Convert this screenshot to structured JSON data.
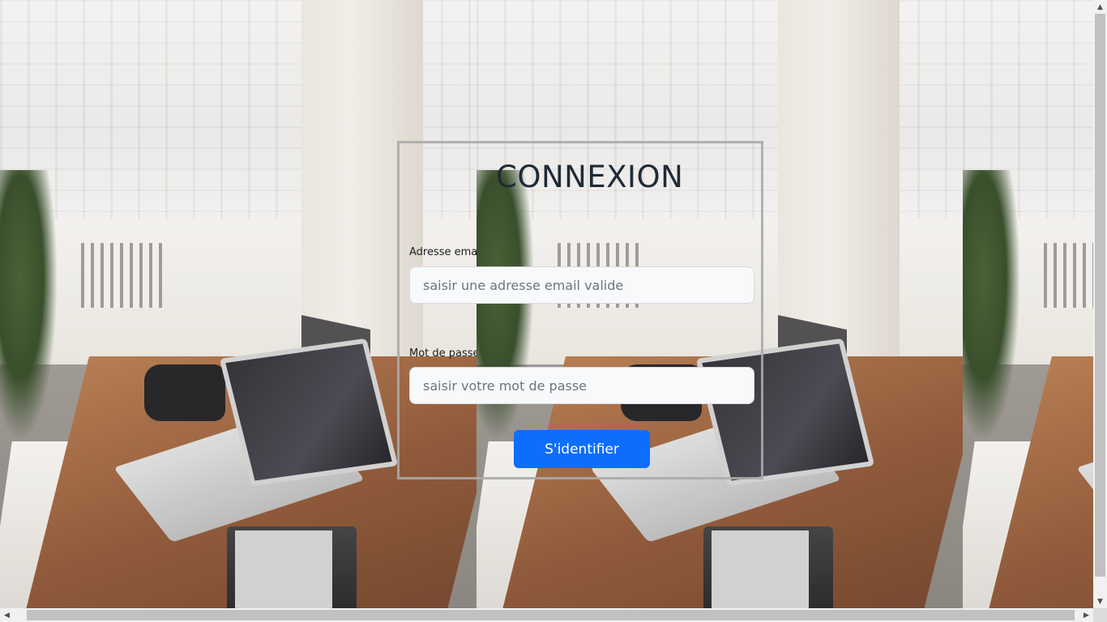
{
  "login": {
    "title": "CONNEXION",
    "email_label": "Adresse email",
    "email_placeholder": "saisir une adresse email valide",
    "email_value": "",
    "password_label": "Mot de passe",
    "password_placeholder": "saisir votre mot de passe",
    "password_value": "",
    "submit_label": "S'identifier"
  },
  "colors": {
    "accent": "#0d6efd",
    "title": "#1f2a36"
  },
  "icons": {
    "scroll_up": "triangle-up-icon",
    "scroll_down": "triangle-down-icon",
    "scroll_left": "triangle-left-icon",
    "scroll_right": "triangle-right-icon"
  }
}
